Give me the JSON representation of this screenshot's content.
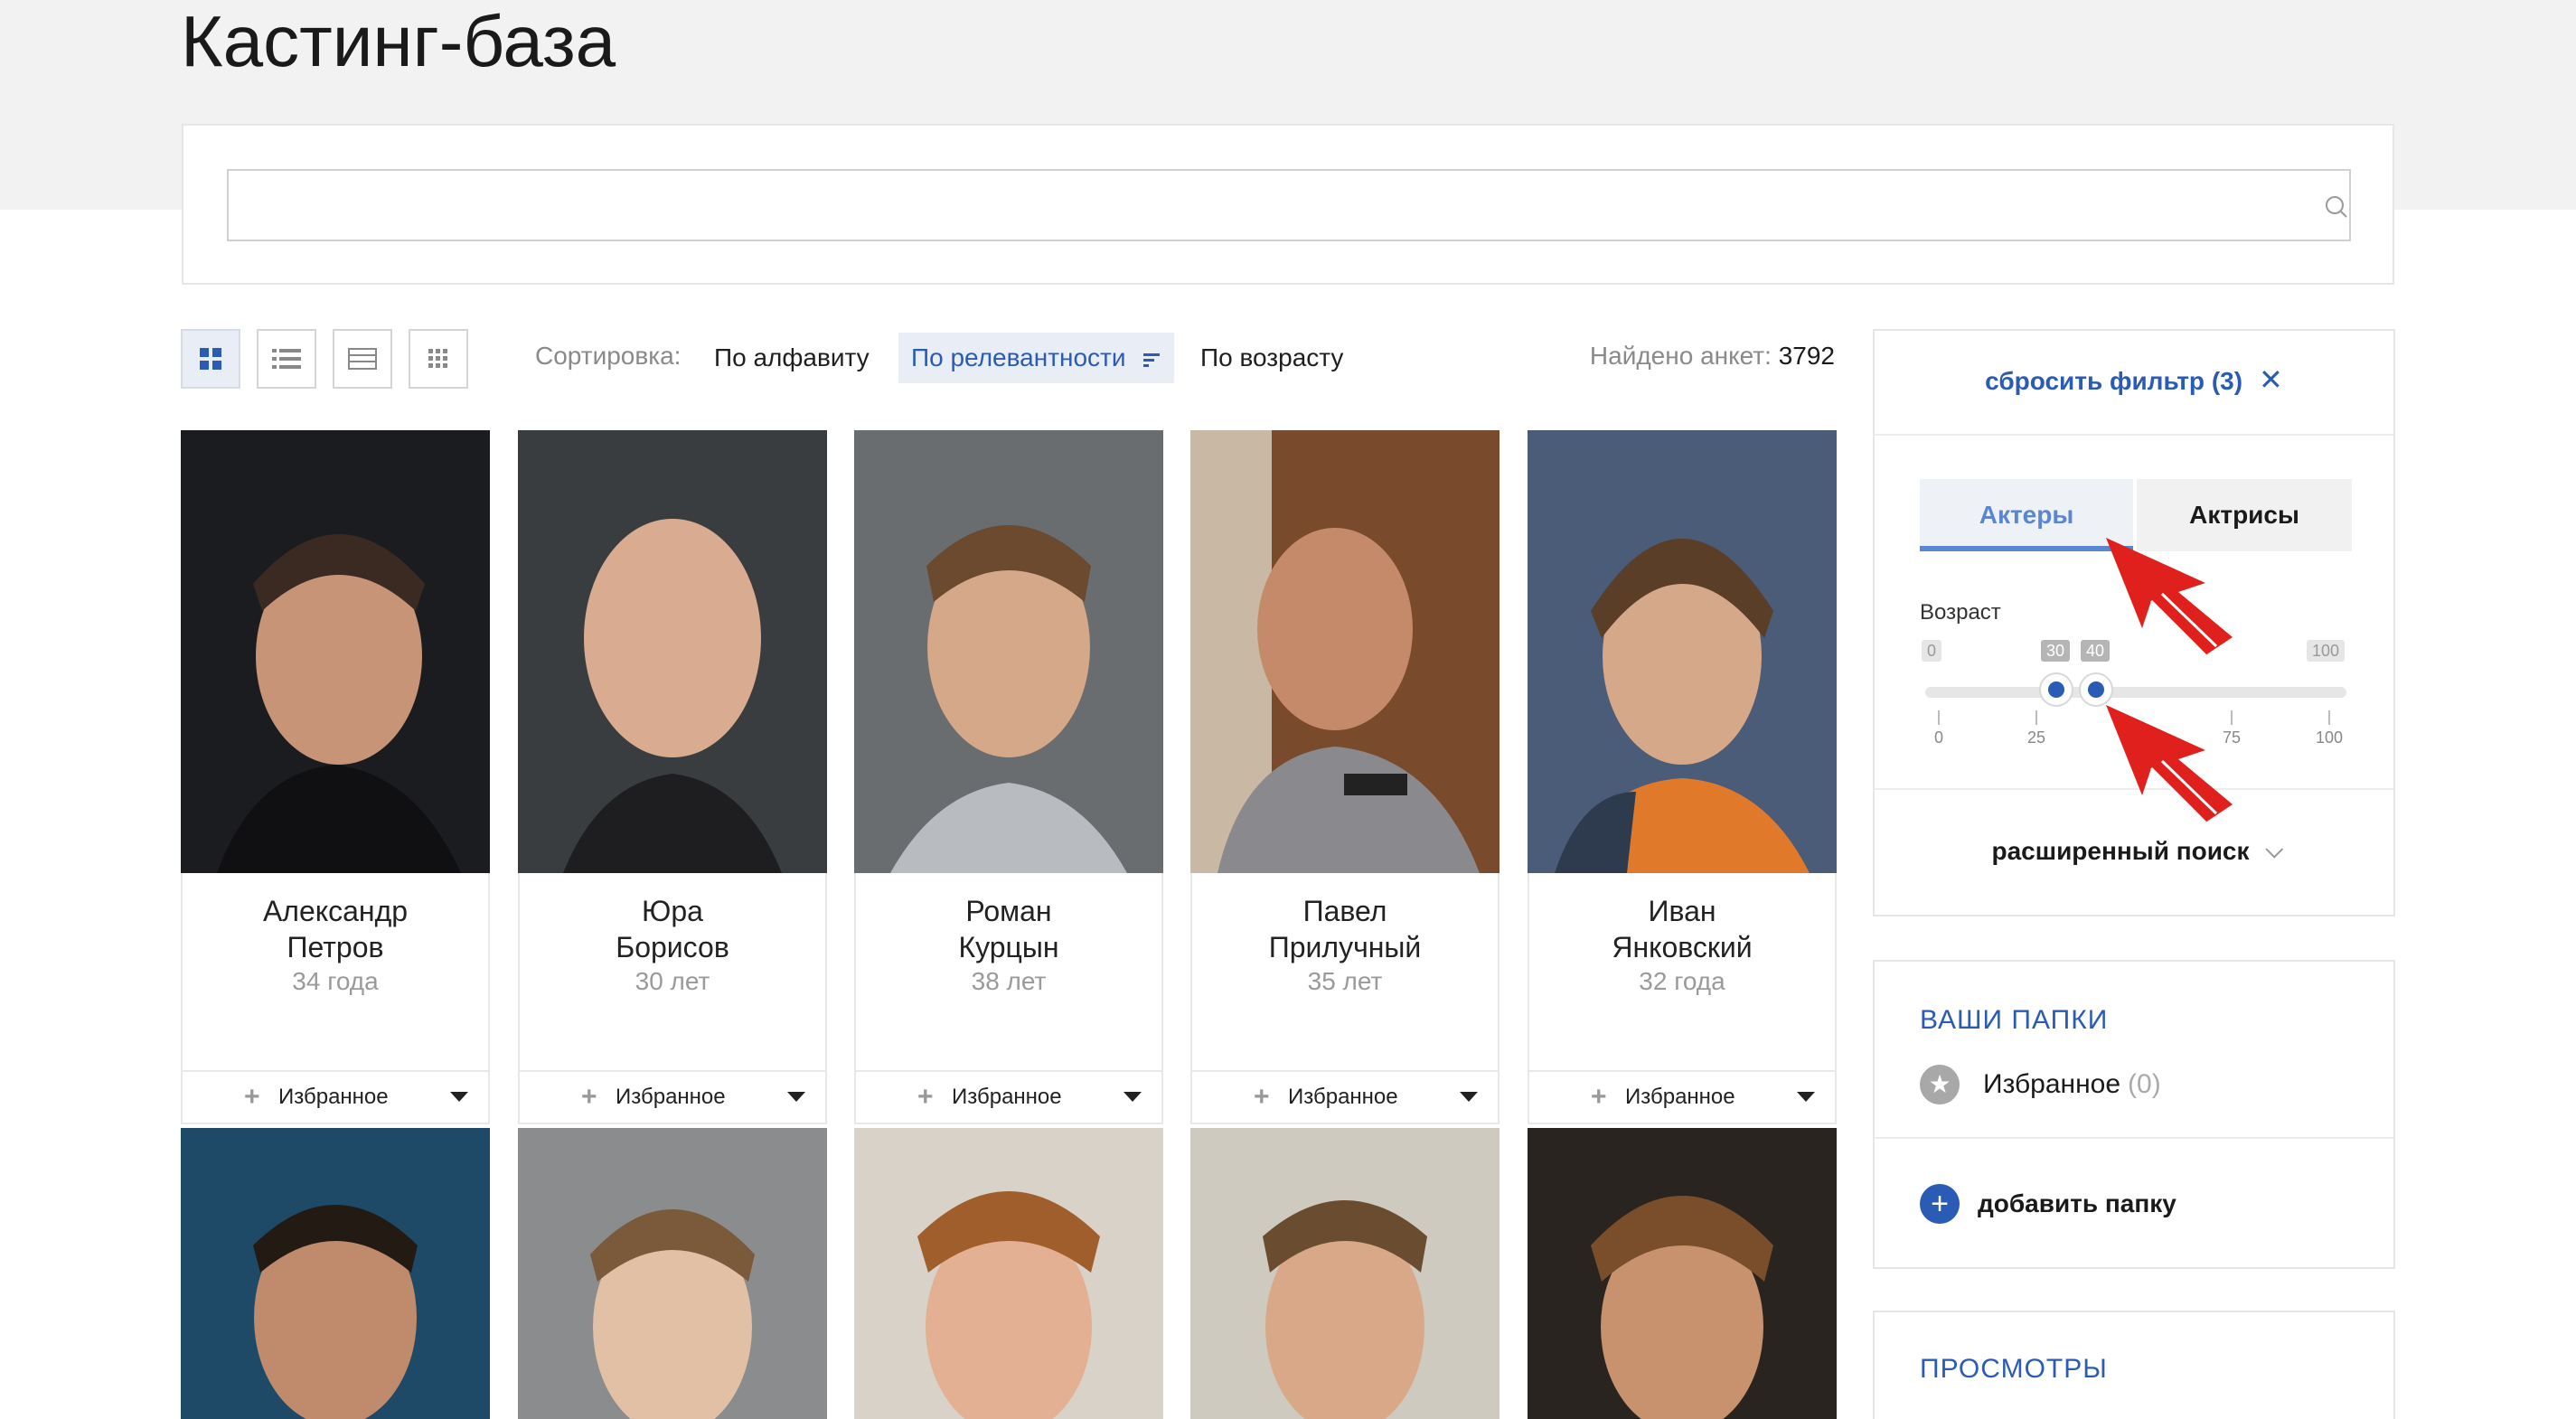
{
  "page": {
    "title": "Кастинг-база"
  },
  "search": {
    "placeholder": "",
    "icon": "search-icon"
  },
  "toolbar": {
    "views": [
      "grid-large-icon",
      "list-icon",
      "table-icon",
      "grid-small-icon"
    ],
    "sort_label": "Сортировка:",
    "sort_options": [
      "По алфавиту",
      "По релевантности",
      "По возрасту"
    ],
    "sort_active": "По релевантности",
    "found_label": "Найдено анкет:",
    "found_count": "3792"
  },
  "cards": [
    {
      "name_first": "Александр",
      "name_last": "Петров",
      "age": "34 года",
      "fav_label": "Избранное"
    },
    {
      "name_first": "Юра",
      "name_last": "Борисов",
      "age": "30 лет",
      "fav_label": "Избранное"
    },
    {
      "name_first": "Роман",
      "name_last": "Курцын",
      "age": "38 лет",
      "fav_label": "Избранное"
    },
    {
      "name_first": "Павел",
      "name_last": "Прилучный",
      "age": "35 лет",
      "fav_label": "Избранное"
    },
    {
      "name_first": "Иван",
      "name_last": "Янковский",
      "age": "32 года",
      "fav_label": "Избранное"
    }
  ],
  "filter": {
    "reset_label": "сбросить фильтр (3)",
    "tabs": [
      "Актеры",
      "Актрисы"
    ],
    "active_tab": "Актеры",
    "age_label": "Возраст",
    "age_min": "0",
    "age_max": "100",
    "age_from": "30",
    "age_to": "40",
    "ticks": [
      "0",
      "25",
      "75",
      "100"
    ],
    "advanced_label": "расширенный поиск"
  },
  "folders": {
    "heading": "ВАШИ ПАПКИ",
    "items": [
      {
        "name": "Избранное",
        "count": "(0)"
      }
    ],
    "add_label": "добавить папку"
  },
  "views_panel": {
    "heading": "ПРОСМОТРЫ"
  },
  "colors": {
    "accent": "#2a5bb5",
    "annotation": "#e0201c",
    "page_band": "#f2f2f2"
  }
}
